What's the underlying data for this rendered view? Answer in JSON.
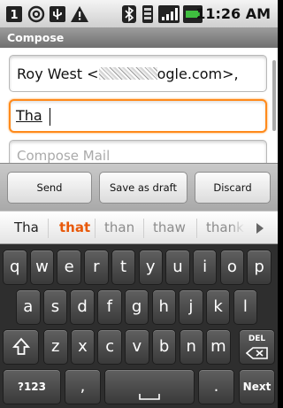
{
  "status_bar": {
    "time": "11:26 AM",
    "icons": [
      "notification-icon",
      "at-icon",
      "usb-icon",
      "warning-icon",
      "bluetooth-icon",
      "vibrate-icon",
      "signal-icon",
      "battery-icon"
    ]
  },
  "title": "Compose",
  "compose": {
    "to_prefix": "Roy West <",
    "to_suffix": "ogle.com>,",
    "cc_value": "Tha",
    "subject_placeholder": "Compose Mail"
  },
  "buttons": {
    "send": "Send",
    "draft": "Save as draft",
    "discard": "Discard"
  },
  "suggestions": [
    "Tha",
    "that",
    "than",
    "thaw",
    "thank"
  ],
  "keyboard": {
    "row1": [
      "q",
      "w",
      "e",
      "r",
      "t",
      "y",
      "u",
      "i",
      "o",
      "p"
    ],
    "row2": [
      "a",
      "s",
      "d",
      "f",
      "g",
      "h",
      "j",
      "k",
      "l"
    ],
    "row3": [
      "z",
      "x",
      "c",
      "v",
      "b",
      "n",
      "m"
    ],
    "delete_label": "DEL",
    "symbols_label": "?123",
    "comma": ",",
    "period": ".",
    "next_label": "Next"
  },
  "colors": {
    "focus": "#ff8a1c",
    "suggestion_highlight": "#e8590a",
    "key_bg": "#4a4a4a"
  }
}
